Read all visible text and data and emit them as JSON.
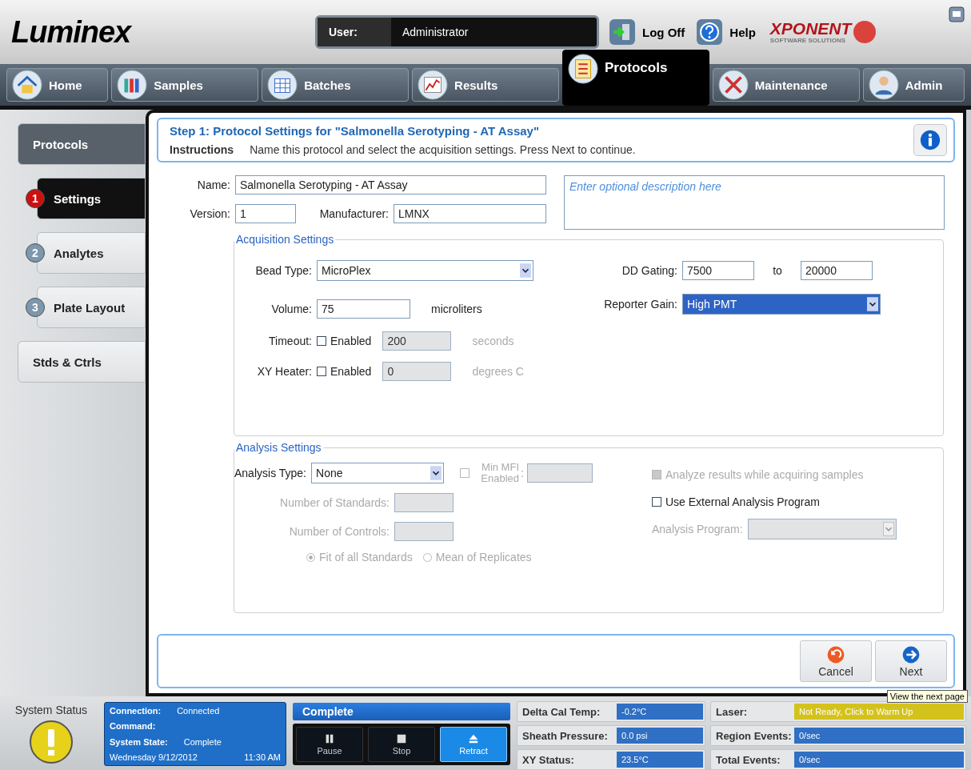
{
  "header": {
    "logo": "Luminex",
    "user_label": "User:",
    "user": "Administrator",
    "logoff": "Log Off",
    "help": "Help",
    "brand": "XPONENT",
    "brand_sub": "SOFTWARE SOLUTIONS"
  },
  "nav_tabs": [
    {
      "label": "Home",
      "selected": false
    },
    {
      "label": "Samples",
      "selected": false
    },
    {
      "label": "Batches",
      "selected": false
    },
    {
      "label": "Results",
      "selected": false
    },
    {
      "label": "Protocols",
      "selected": true
    },
    {
      "label": "Maintenance",
      "selected": false
    },
    {
      "label": "Admin",
      "selected": false
    }
  ],
  "sidebar": [
    {
      "kind": "header",
      "label": "Protocols",
      "selected": false
    },
    {
      "kind": "step",
      "step": "1",
      "label": "Settings",
      "selected": true
    },
    {
      "kind": "step",
      "step": "2",
      "label": "Analytes",
      "selected": false
    },
    {
      "kind": "step",
      "step": "3",
      "label": "Plate Layout",
      "selected": false
    },
    {
      "kind": "plain",
      "label": "Stds & Ctrls",
      "selected": false
    }
  ],
  "step": {
    "title": "Step 1: Protocol Settings for \"Salmonella Serotyping - AT Assay\"",
    "instructions_label": "Instructions",
    "instructions": "Name this protocol and select the acquisition settings.  Press Next to continue."
  },
  "form": {
    "name_label": "Name:",
    "name": "Salmonella Serotyping - AT Assay",
    "version_label": "Version:",
    "version": "1",
    "manufacturer_label": "Manufacturer:",
    "manufacturer": "LMNX",
    "description_placeholder": "Enter optional description here"
  },
  "acquisition": {
    "title": "Acquisition Settings",
    "bead_type_label": "Bead Type:",
    "bead_type": "MicroPlex",
    "volume_label": "Volume:",
    "volume": "75",
    "volume_unit": "microliters",
    "timeout": {
      "label": "Timeout:",
      "check_label": "Enabled",
      "checked": false,
      "value": "200",
      "unit": "seconds",
      "disabled": true
    },
    "xy_heater": {
      "label": "XY Heater:",
      "check_label": "Enabled",
      "checked": false,
      "value": "0",
      "unit": "degrees C",
      "disabled": true
    },
    "dd_gating_label": "DD Gating:",
    "dd_from": "7500",
    "dd_to_label": "to",
    "dd_to": "20000",
    "reporter_gain_label": "Reporter Gain:",
    "reporter_gain": "High PMT",
    "reporter_gain_focused": true
  },
  "analysis": {
    "title": "Analysis Settings",
    "type_label": "Analysis Type:",
    "type": "None",
    "min_mfi": {
      "label": "Min MFI Enabled",
      "colon": ":",
      "checked": false,
      "disabled": true
    },
    "standards_label": "Number of Standards:",
    "controls_label": "Number of Controls:",
    "fields_disabled": true,
    "radios": [
      {
        "label": "Fit of all Standards",
        "selected": true,
        "disabled": true
      },
      {
        "label": "Mean of Replicates",
        "selected": false,
        "disabled": true
      }
    ],
    "checks": [
      {
        "label": "Analyze results while acquiring samples",
        "checked": true,
        "disabled": true
      },
      {
        "label": "Use External Analysis Program",
        "checked": false,
        "disabled": false
      }
    ],
    "program_label": "Analysis Program:",
    "program_disabled": true
  },
  "buttons": [
    {
      "kind": "cancel",
      "label": "Cancel"
    },
    {
      "kind": "next",
      "label": "Next"
    }
  ],
  "tooltip": "View the next page",
  "status": {
    "title": "System Status",
    "connection_label": "Connection:",
    "connection": "Connected",
    "command_label": "Command:",
    "state_label": "System State:",
    "state": "Complete",
    "date": "Wednesday 9/12/2012",
    "time": "11:30 AM",
    "banner": "Complete",
    "controls": [
      {
        "kind": "pause",
        "label": "Pause",
        "active": false
      },
      {
        "kind": "stop",
        "label": "Stop",
        "active": false
      },
      {
        "kind": "retract",
        "label": "Retract",
        "active": true
      }
    ],
    "readings": [
      {
        "label": "Delta Cal Temp:",
        "value": "-0.2°C",
        "color": "#2f6fc4"
      },
      {
        "label": "Laser:",
        "value": "Not Ready, Click to Warm Up",
        "color": "#d4c21c"
      },
      {
        "label": "Sheath Pressure:",
        "value": "0.0 psi",
        "color": "#2f6fc4"
      },
      {
        "label": "Region Events:",
        "value": "0/sec",
        "color": "#2f6fc4"
      },
      {
        "label": "XY Status:",
        "value": "23.5°C",
        "color": "#2f6fc4"
      },
      {
        "label": "Total Events:",
        "value": "0/sec",
        "color": "#2f6fc4"
      }
    ]
  }
}
